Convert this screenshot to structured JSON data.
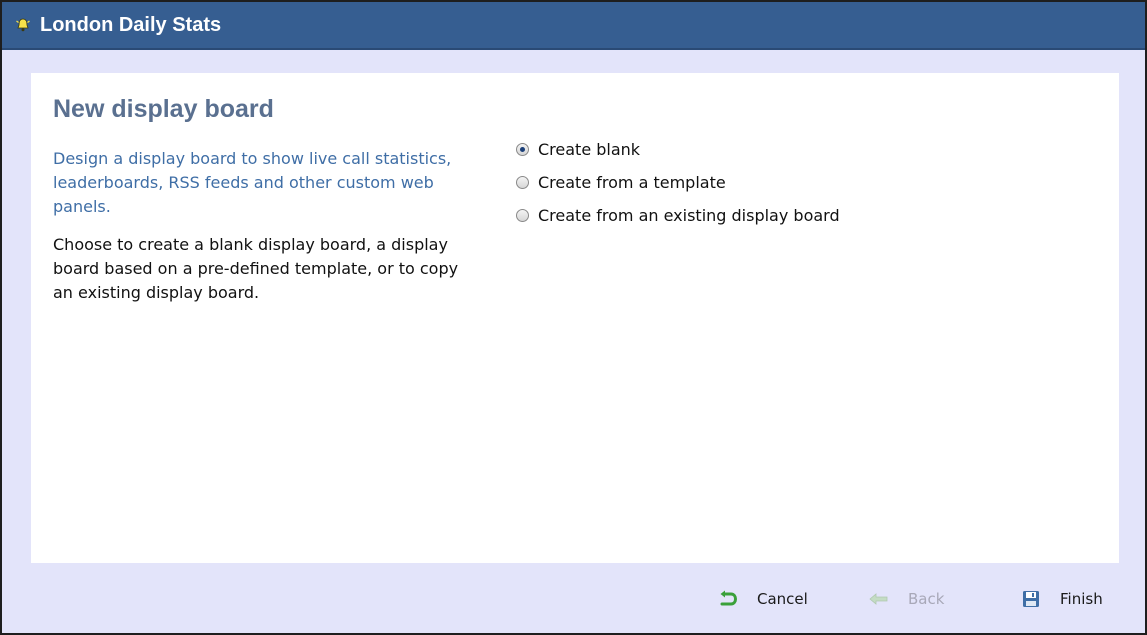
{
  "window": {
    "title": "London Daily Stats",
    "title_icon": "bell-icon"
  },
  "main": {
    "heading": "New display board",
    "intro": "Design a display board to show live call statistics, leaderboards, RSS feeds and other custom web panels.",
    "description": "Choose to create a blank display board, a display board based on a pre-defined template, or to copy an existing display board.",
    "options": [
      {
        "label": "Create blank",
        "selected": true
      },
      {
        "label": "Create from a template",
        "selected": false
      },
      {
        "label": "Create from an existing display board",
        "selected": false
      }
    ]
  },
  "footer": {
    "cancel_label": "Cancel",
    "back_label": "Back",
    "finish_label": "Finish",
    "back_enabled": false
  },
  "colors": {
    "titlebar": "#365e91",
    "background": "#e3e4fa",
    "heading": "#5a7090",
    "intro_text": "#3f6ea6"
  }
}
